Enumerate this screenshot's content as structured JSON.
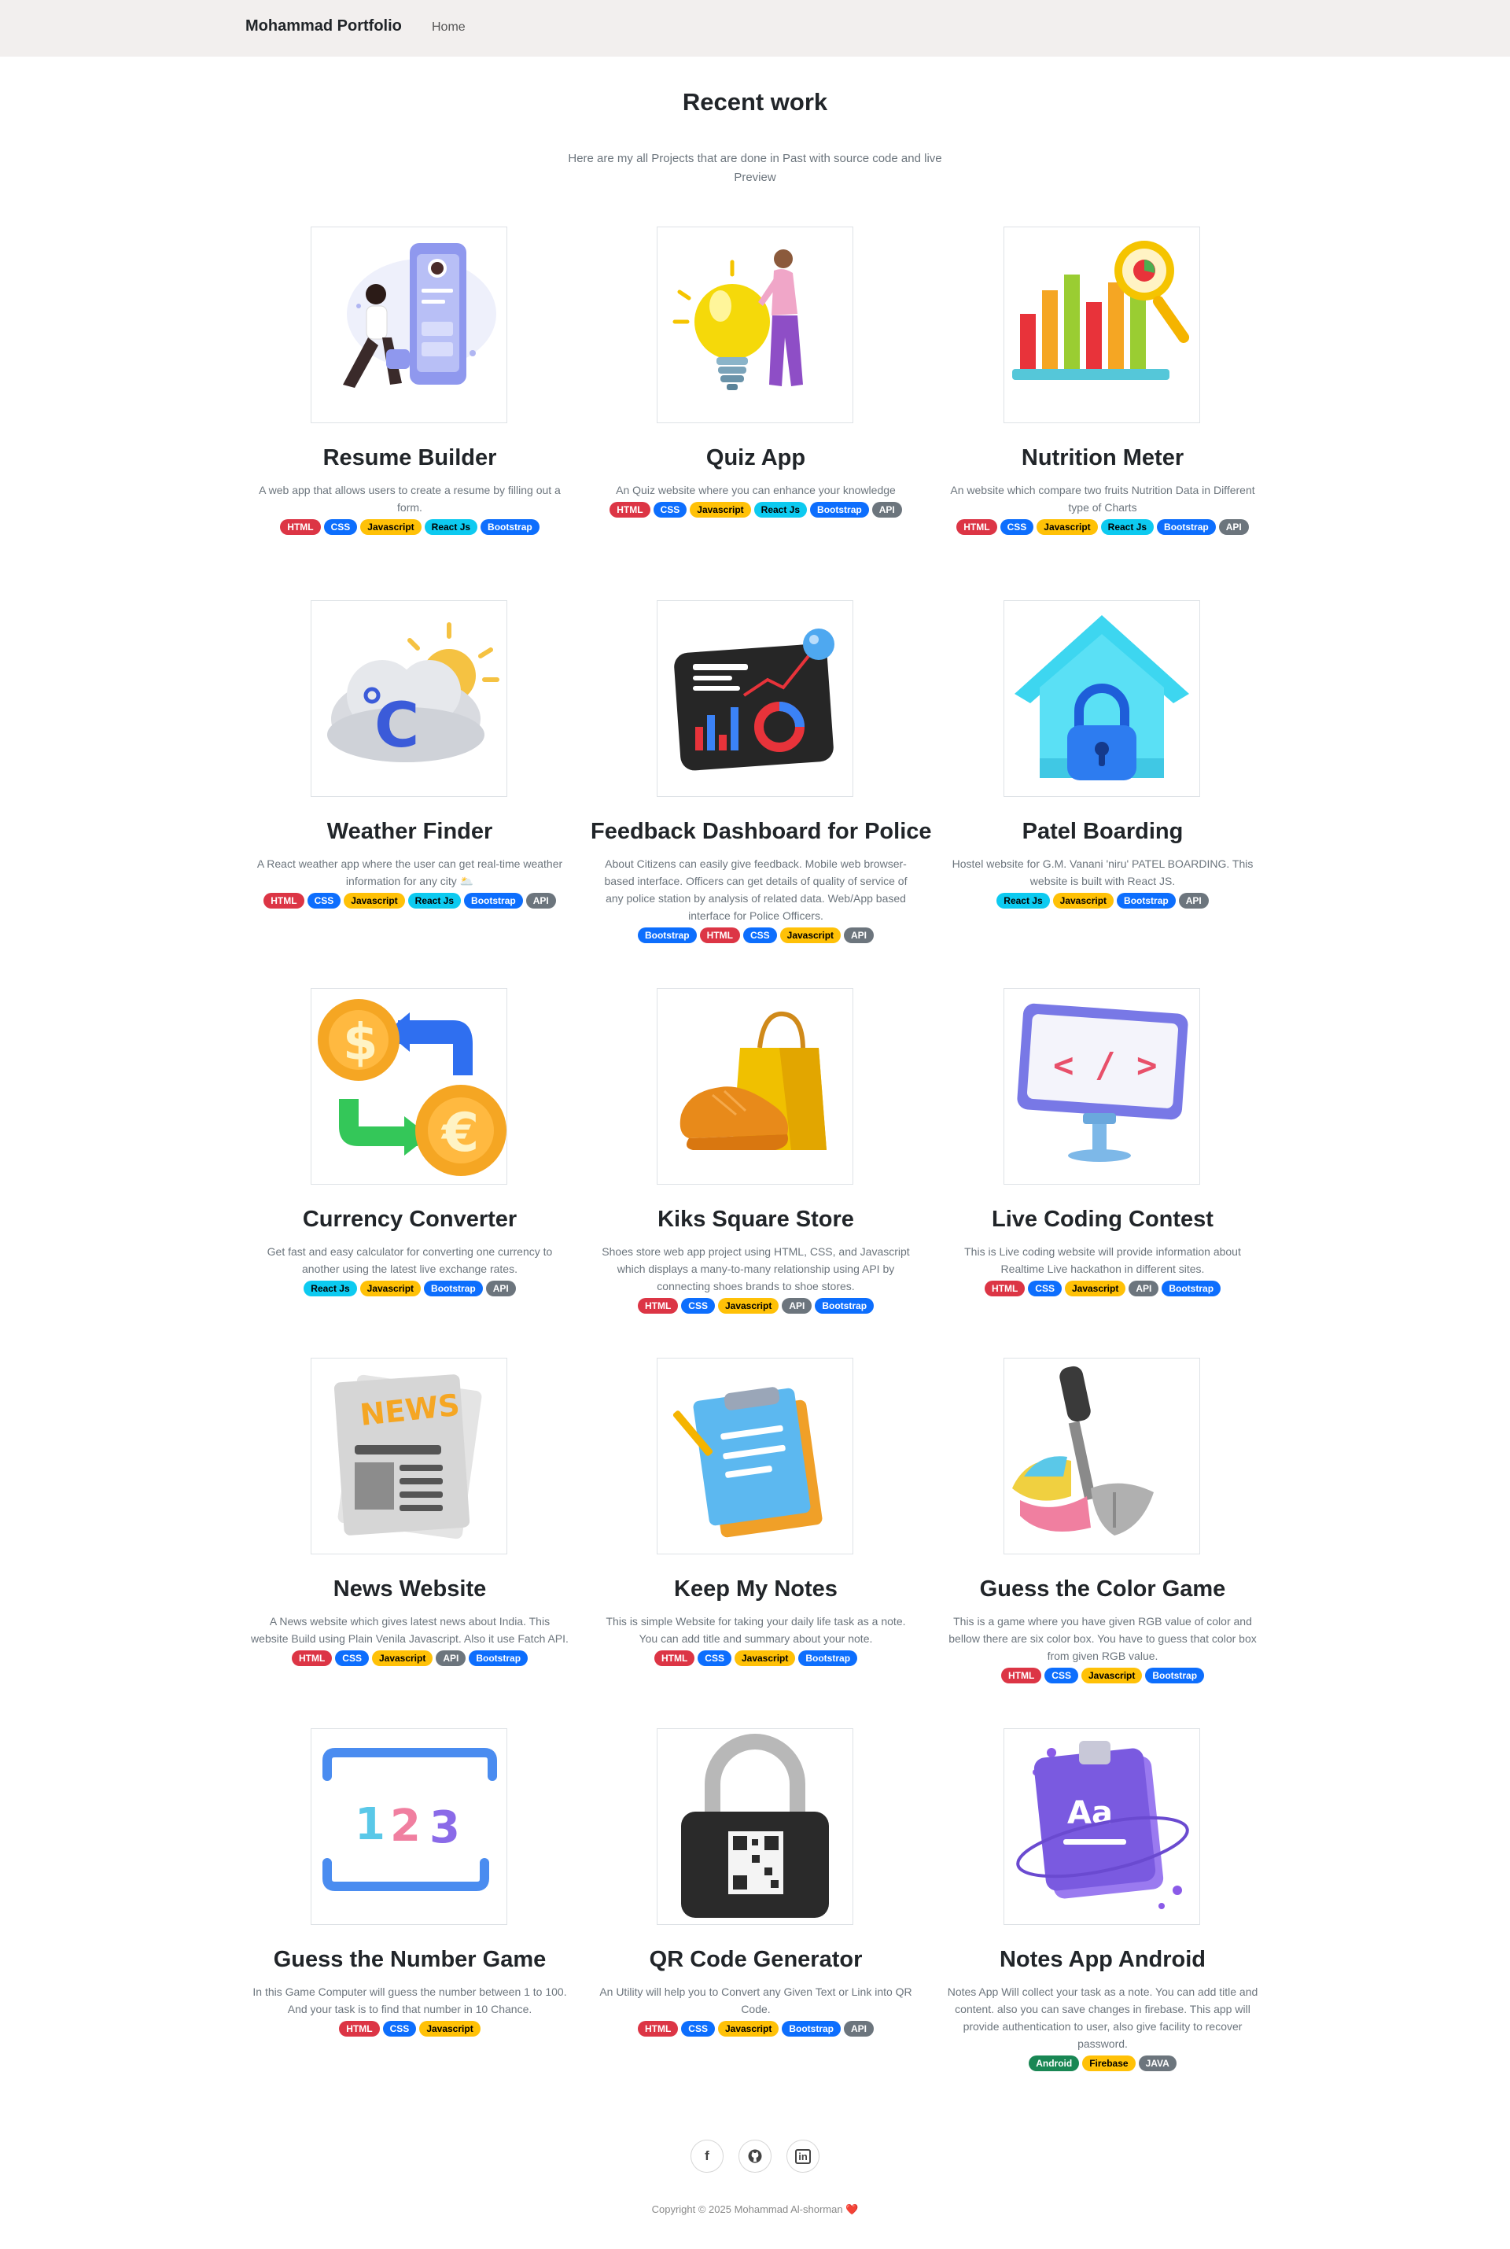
{
  "nav": {
    "brand": "Mohammad Portfolio",
    "home": "Home"
  },
  "header": {
    "title": "Recent work",
    "subtitle": "Here are my all Projects that are done in Past with source code and live Preview"
  },
  "projects": [
    {
      "title": "Resume Builder",
      "description": "A web app that allows users to create a resume by filling out a form.",
      "icon": "resume-illustration",
      "badges": [
        "HTML",
        "CSS",
        "Javascript",
        "React Js",
        "Bootstrap"
      ]
    },
    {
      "title": "Quiz App",
      "description": "An Quiz website where you can enhance your knowledge",
      "icon": "lightbulb-illustration",
      "badges": [
        "HTML",
        "CSS",
        "Javascript",
        "React Js",
        "Bootstrap",
        "API"
      ]
    },
    {
      "title": "Nutrition Meter",
      "description": "An website which compare two fruits Nutrition Data in Different type of Charts",
      "icon": "bar-chart-magnifier-illustration",
      "badges": [
        "HTML",
        "CSS",
        "Javascript",
        "React Js",
        "Bootstrap",
        "API"
      ]
    },
    {
      "title": "Weather Finder",
      "description": "A React weather app where the user can get real-time weather information for any city 🌥️",
      "icon": "weather-cloud-illustration",
      "badges": [
        "HTML",
        "CSS",
        "Javascript",
        "React Js",
        "Bootstrap",
        "API"
      ]
    },
    {
      "title": "Feedback Dashboard for Police",
      "description": "About Citizens can easily give feedback. Mobile web browser-based interface. Officers can get details of quality of service of any police station by analysis of related data. Web/App based interface for Police Officers.",
      "icon": "dashboard-illustration",
      "badges": [
        "Bootstrap",
        "HTML",
        "CSS",
        "Javascript",
        "API"
      ]
    },
    {
      "title": "Patel Boarding",
      "description": "Hostel website for G.M. Vanani 'niru' PATEL BOARDING. This website is built with React JS.",
      "icon": "house-lock-illustration",
      "badges": [
        "React Js",
        "Javascript",
        "Bootstrap",
        "API"
      ]
    },
    {
      "title": "Currency Converter",
      "description": "Get fast and easy calculator for converting one currency to another using the latest live exchange rates.",
      "icon": "currency-exchange-illustration",
      "badges": [
        "React Js",
        "Javascript",
        "Bootstrap",
        "API"
      ]
    },
    {
      "title": "Kiks Square Store",
      "description": "Shoes store web app project using HTML, CSS, and Javascript which displays a many-to-many relationship using API by connecting shoes brands to shoe stores.",
      "icon": "shoe-bag-illustration",
      "badges": [
        "HTML",
        "CSS",
        "Javascript",
        "API",
        "Bootstrap"
      ]
    },
    {
      "title": "Live Coding Contest",
      "description": "This is Live coding website will provide information about Realtime Live hackathon in different sites.",
      "icon": "code-screen-illustration",
      "badges": [
        "HTML",
        "CSS",
        "Javascript",
        "API",
        "Bootstrap"
      ]
    },
    {
      "title": "News Website",
      "description": "A News website which gives latest news about India. This website Build using Plain Venila Javascript. Also it use Fatch API.",
      "icon": "newspaper-illustration",
      "badges": [
        "HTML",
        "CSS",
        "Javascript",
        "API",
        "Bootstrap"
      ]
    },
    {
      "title": "Keep My Notes",
      "description": "This is simple Website for taking your daily life task as a note. You can add title and summary about your note.",
      "icon": "notepad-illustration",
      "badges": [
        "HTML",
        "CSS",
        "Javascript",
        "Bootstrap"
      ]
    },
    {
      "title": "Guess the Color Game",
      "description": "This is a game where you have given RGB value of color and bellow there are six color box. You have to guess that color box from given RGB value.",
      "icon": "color-dropper-illustration",
      "badges": [
        "HTML",
        "CSS",
        "Javascript",
        "Bootstrap"
      ]
    },
    {
      "title": "Guess the Number Game",
      "description": "In this Game Computer will guess the number between 1 to 100. And your task is to find that number in 10 Chance.",
      "icon": "numbers-123-illustration",
      "badges": [
        "HTML",
        "CSS",
        "Javascript"
      ]
    },
    {
      "title": "QR Code Generator",
      "description": "An Utility will help you to Convert any Given Text or Link into QR Code.",
      "icon": "qr-padlock-illustration",
      "badges": [
        "HTML",
        "CSS",
        "Javascript",
        "Bootstrap",
        "API"
      ]
    },
    {
      "title": "Notes App Android",
      "description": "Notes App Will collect your task as a note. You can add title and content. also you can save changes in firebase. This app will provide authentication to user, also give facility to recover password.",
      "icon": "notes-app-illustration",
      "badges": [
        "Android",
        "Firebase",
        "JAVA"
      ]
    }
  ],
  "footer": {
    "social": [
      {
        "name": "facebook-icon",
        "glyph": "f"
      },
      {
        "name": "github-icon",
        "glyph": "◉"
      },
      {
        "name": "linkedin-icon",
        "glyph": "in"
      }
    ],
    "copyright": "Copyright © 2025 Mohammad Al-shorman",
    "heart": "❤️"
  },
  "badge_colors": {
    "HTML": "#dc3545",
    "CSS": "#0d6efd",
    "Javascript": "#ffc107",
    "React Js": "#0dcaf0",
    "Bootstrap": "#0d6efd",
    "API": "#6c757d",
    "Android": "#198754",
    "Firebase": "#ffc107",
    "JAVA": "#6c757d"
  }
}
